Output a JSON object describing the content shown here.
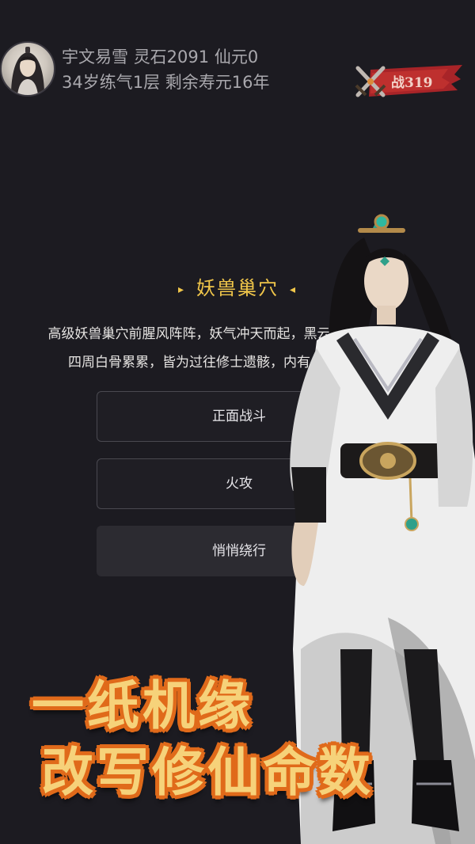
{
  "player": {
    "name": "宇文易雪",
    "spirit_stones": "灵石2091",
    "immortal_yuan": "仙元0",
    "age_level": "34岁练气1层",
    "lifespan": "剩余寿元16年"
  },
  "battle_badge": {
    "label": "战319",
    "icon": "crossed-swords-icon"
  },
  "scene": {
    "title": "妖兽巢穴",
    "title_mark_left": "▸",
    "title_mark_right": "◂",
    "description_line1": "高级妖兽巢穴前腥风阵阵，妖气冲天而起，黑云",
    "description_line2": "四周白骨累累，皆为过往修士遗骸，内有"
  },
  "choices": [
    {
      "label": "正面战斗"
    },
    {
      "label": "火攻"
    },
    {
      "label": "悄悄绕行"
    }
  ],
  "slogan": {
    "line1": "一纸机缘",
    "line2": "改写修仙命数"
  },
  "colors": {
    "background": "#1c1b21",
    "title_gold": "#f0c64a",
    "slogan_fill": "#f6d27a",
    "slogan_outline": "#e06a1a",
    "badge_red": "#b3262a"
  }
}
